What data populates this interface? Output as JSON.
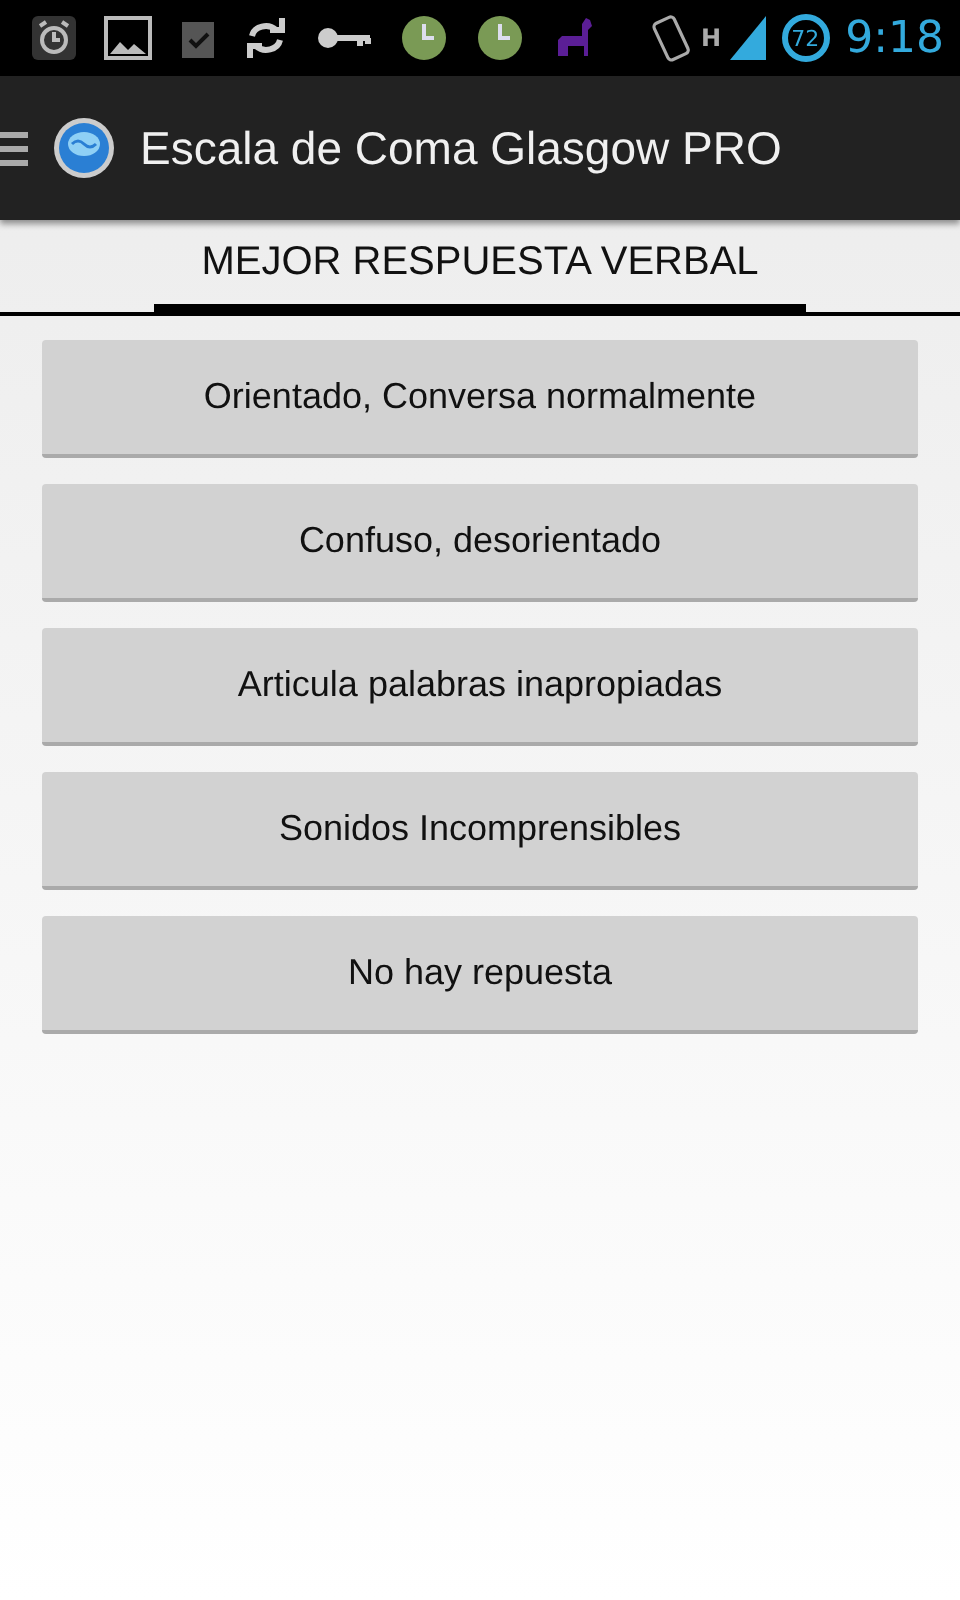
{
  "status_bar": {
    "network_type": "H",
    "battery": "72",
    "time": "9:18"
  },
  "action_bar": {
    "title": "Escala de Coma Glasgow PRO"
  },
  "section": {
    "title": "MEJOR RESPUESTA VERBAL"
  },
  "options": [
    {
      "label": "Orientado, Conversa normalmente"
    },
    {
      "label": "Confuso, desorientado"
    },
    {
      "label": "Articula palabras inapropiadas"
    },
    {
      "label": "Sonidos Incomprensibles"
    },
    {
      "label": "No hay repuesta"
    }
  ]
}
